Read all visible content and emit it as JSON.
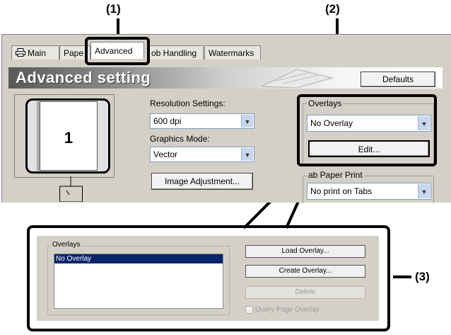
{
  "callouts": {
    "c1": "(1)",
    "c2": "(2)",
    "c3": "(3)"
  },
  "tabs": {
    "main": "Main",
    "paper": "Pape",
    "advanced": "Advanced",
    "job_handling": "ob Handling",
    "watermarks": "Watermarks"
  },
  "banner": {
    "title": "Advanced setting"
  },
  "defaults_button": "Defaults",
  "preview": {
    "page_number": "1"
  },
  "resolution": {
    "label": "Resolution Settings:",
    "value": "600 dpi"
  },
  "graphics": {
    "label": "Graphics Mode:",
    "value": "Vector"
  },
  "image_adjustment_button": "Image Adjustment...",
  "overlays_group": {
    "title": "Overlays",
    "value": "No Overlay",
    "edit_button": "Edit..."
  },
  "tab_paper_print": {
    "title": "ab Paper Print",
    "value": "No print on Tabs"
  },
  "overlay_dialog": {
    "group_title": "Overlays",
    "list_items": [
      "No Overlay"
    ],
    "load_button": "Load Overlay...",
    "create_button": "Create Overlay...",
    "delete_button": "Delete",
    "query_checkbox_label": "Query Page Overlay",
    "query_checked": false
  },
  "colors": {
    "selection": "#0a246a",
    "dialog_bg": "#d4d0c8"
  }
}
